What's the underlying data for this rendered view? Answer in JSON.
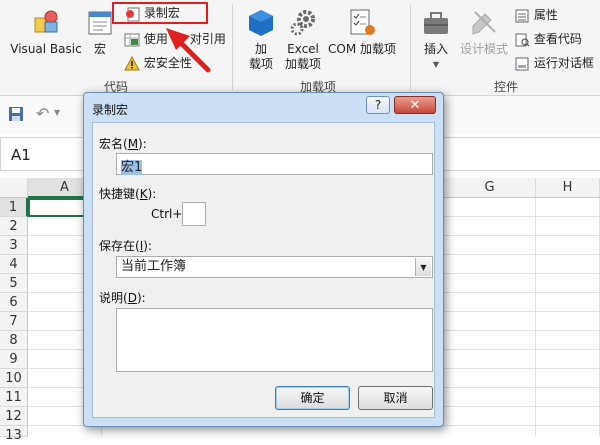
{
  "ribbon": {
    "visual_basic": "Visual Basic",
    "macros": "宏",
    "record_macro": "录制宏",
    "relative_ref_prefix": "使用",
    "relative_ref_suffix": "对引用",
    "macro_security": "宏安全性",
    "group_code": "代码",
    "addins_1": "加",
    "addins_2": "载项",
    "excel_addins_1": "Excel",
    "excel_addins_2": "加载项",
    "com_addins": "COM 加载项",
    "group_addins": "加载项",
    "insert": "插入",
    "design_mode": "设计模式",
    "properties": "属性",
    "view_code": "查看代码",
    "run_dialog": "运行对话框",
    "group_controls": "控件"
  },
  "namebox": {
    "value": "A1"
  },
  "sheet": {
    "columns": [
      "A",
      "G",
      "H"
    ],
    "rows": [
      "1",
      "2",
      "3",
      "4",
      "5",
      "6",
      "7",
      "8",
      "9",
      "10",
      "11",
      "12",
      "13"
    ]
  },
  "dialog": {
    "title": "录制宏",
    "help": "?",
    "macro_name_label": "宏名(",
    "macro_name_key": "M",
    "macro_name_close": "):",
    "macro_name_value": "宏1",
    "shortcut_label": "快捷键(",
    "shortcut_key": "K",
    "shortcut_close": "):",
    "ctrl": "Ctrl+",
    "shortcut_value": "",
    "store_label": "保存在(",
    "store_key": "I",
    "store_close": "):",
    "store_value": "当前工作簿",
    "desc_label": "说明(",
    "desc_key": "D",
    "desc_close": "):",
    "desc_value": "",
    "ok": "确定",
    "cancel": "取消"
  },
  "colors": {
    "accent_red": "#e02020",
    "dialog_frame": "#cbe0f5",
    "cell_select": "#217346"
  }
}
